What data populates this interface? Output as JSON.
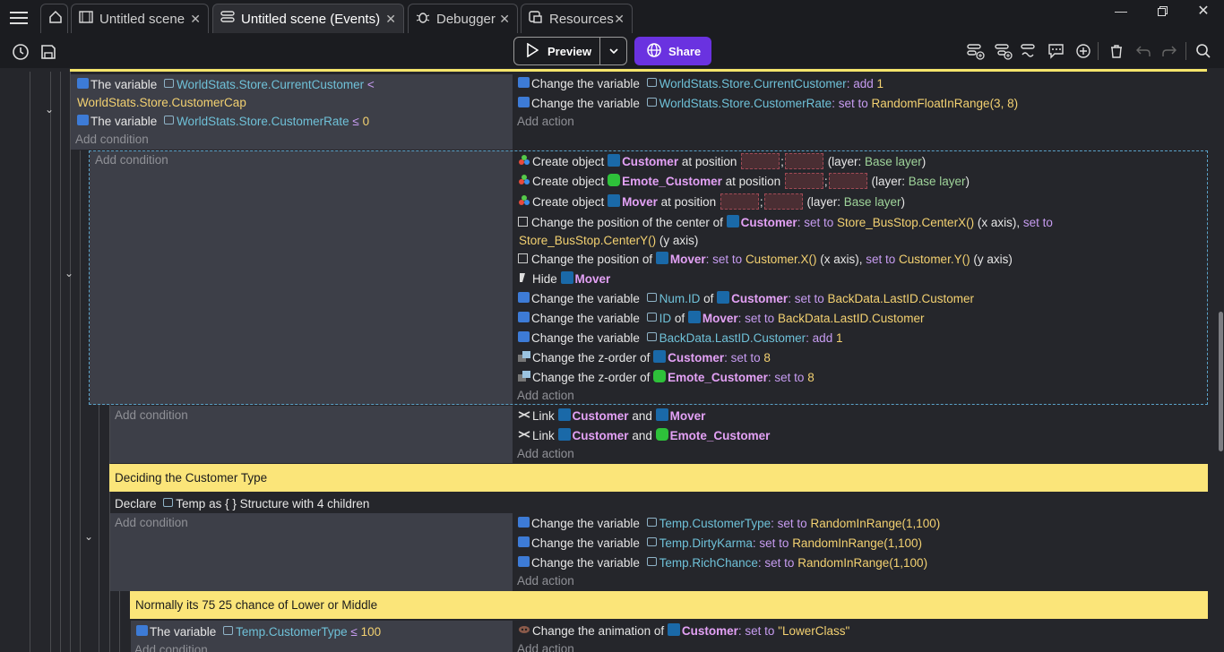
{
  "tabs": [
    {
      "label": "Untitled scene",
      "icon": "film-icon"
    },
    {
      "label": "Untitled scene (Events)",
      "icon": "events-list-icon"
    },
    {
      "label": "Debugger",
      "icon": "bug-icon"
    },
    {
      "label": "Resources",
      "icon": "resources-icon"
    }
  ],
  "toolbar": {
    "preview_label": "Preview",
    "share_label": "Share"
  },
  "ev1": {
    "cond_a_prefix": "The variable",
    "cond_a_var": "WorldStats.Store.CurrentCustomer",
    "cond_a_op": "<",
    "cond_a_val": "WorldStats.Store.CustomerCap",
    "cond_b_prefix": "The variable",
    "cond_b_var": "WorldStats.Store.CustomerRate",
    "cond_b_op": "≤",
    "cond_b_val": "0",
    "add_condition": "Add condition",
    "act1_text": "Change the variable",
    "act1_var": "WorldStats.Store.CurrentCustomer",
    "act1_op": ": add",
    "act1_val": "1",
    "act2_text": "Change the variable",
    "act2_var": "WorldStats.Store.CustomerRate",
    "act2_op": ": set to",
    "act2_val": "RandomFloatInRange(3, 8)",
    "add_action": "Add action"
  },
  "ev2": {
    "add_condition": "Add condition",
    "a1_pre": "Create object",
    "a1_obj": "Customer",
    "a1_mid": "at position",
    "a1_sep": ";",
    "a1_layer_pre": "(layer:",
    "a1_layer": "Base layer",
    "a1_layer_post": ")",
    "a2_pre": "Create object",
    "a2_obj": "Emote_Customer",
    "a2_mid": "at position",
    "a2_sep": ";",
    "a2_layer_pre": "(layer:",
    "a2_layer": "Base layer",
    "a2_layer_post": ")",
    "a3_pre": "Create object",
    "a3_obj": "Mover",
    "a3_mid": "at position",
    "a3_sep": ";",
    "a3_layer_pre": "(layer:",
    "a3_layer": "Base layer",
    "a3_layer_post": ")",
    "a4_pre": "Change the position of the center of",
    "a4_obj": "Customer",
    "a4_op1": ": set to",
    "a4_val1": "Store_BusStop.CenterX()",
    "a4_x": "(x axis),",
    "a4_op2": "set to",
    "a4_val2": "Store_BusStop.CenterY()",
    "a4_y": "(y axis)",
    "a5_pre": "Change the position of",
    "a5_obj": "Mover",
    "a5_op1": ": set to",
    "a5_val1": "Customer.X()",
    "a5_x": "(x axis),",
    "a5_op2": "set to",
    "a5_val2": "Customer.Y()",
    "a5_y": "(y axis)",
    "a6_pre": "Hide",
    "a6_obj": "Mover",
    "a7_pre": "Change the variable",
    "a7_var": "Num.ID",
    "a7_of": "of",
    "a7_obj": "Customer",
    "a7_op": ": set to",
    "a7_val": "BackData.LastID.Customer",
    "a8_pre": "Change the variable",
    "a8_var": "ID",
    "a8_of": "of",
    "a8_obj": "Mover",
    "a8_op": ": set to",
    "a8_val": "BackData.LastID.Customer",
    "a9_pre": "Change the variable",
    "a9_var": "BackData.LastID.Customer",
    "a9_op": ": add",
    "a9_val": "1",
    "a10_pre": "Change the z-order of",
    "a10_obj": "Customer",
    "a10_op": ": set to",
    "a10_val": "8",
    "a11_pre": "Change the z-order of",
    "a11_obj": "Emote_Customer",
    "a11_op": ": set to",
    "a11_val": "8",
    "add_action": "Add action"
  },
  "ev3": {
    "add_condition": "Add condition",
    "a1_pre": "Link",
    "a1_obj1": "Customer",
    "a1_and": "and",
    "a1_obj2": "Mover",
    "a2_pre": "Link",
    "a2_obj1": "Customer",
    "a2_and": "and",
    "a2_obj2": "Emote_Customer",
    "add_action": "Add action"
  },
  "comment1": "Deciding the Customer Type",
  "declare": {
    "pre": "Declare",
    "var": "Temp",
    "as": "as",
    "type": "{ } Structure with 4 children"
  },
  "ev4": {
    "add_condition": "Add condition",
    "a1_pre": "Change the variable",
    "a1_var": "Temp.CustomerType",
    "a1_op": ": set to",
    "a1_val": "RandomInRange(1,100)",
    "a2_pre": "Change the variable",
    "a2_var": "Temp.DirtyKarma",
    "a2_op": ": set to",
    "a2_val": "RandomInRange(1,100)",
    "a3_pre": "Change the variable",
    "a3_var": "Temp.RichChance",
    "a3_op": ": set to",
    "a3_val": "RandomInRange(1,100)",
    "add_action": "Add action"
  },
  "comment2": "Normally its 75 25 chance of Lower or Middle",
  "ev5": {
    "c1_pre": "The variable",
    "c1_var": "Temp.CustomerType",
    "c1_op": "≤",
    "c1_val": "100",
    "add_condition": "Add condition",
    "a1_pre": "Change the animation of",
    "a1_obj": "Customer",
    "a1_op": ": set to",
    "a1_val": "\"LowerClass\"",
    "add_action": "Add action"
  },
  "colors": {
    "accent": "#6a32e0",
    "comment_bg": "#fbe579",
    "condition_bg": "#3d3f48",
    "object_name": "#e3a1f5",
    "value": "#f3d171",
    "variable": "#6fc1d8"
  }
}
